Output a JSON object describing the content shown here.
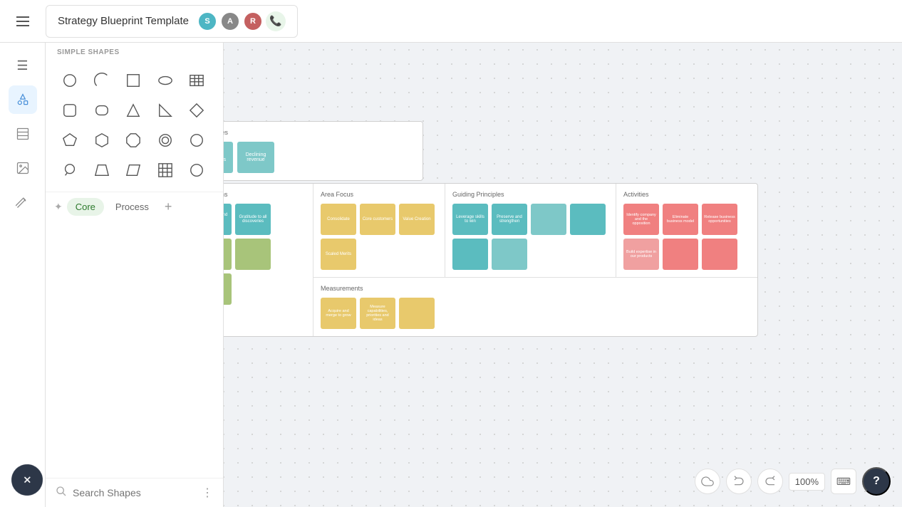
{
  "topbar": {
    "menu_label": "☰",
    "doc_title": "Strategy Blueprint Template"
  },
  "avatars": [
    {
      "initial": "S",
      "color": "#4db6c4"
    },
    {
      "initial": "A",
      "color": "#888"
    },
    {
      "initial": "R",
      "color": "#c46060"
    }
  ],
  "sidebar": {
    "items": [
      {
        "name": "menu-icon",
        "icon": "☰",
        "active": false
      },
      {
        "name": "shapes-icon",
        "icon": "✦",
        "active": true
      },
      {
        "name": "frame-icon",
        "icon": "⊞",
        "active": false
      },
      {
        "name": "image-icon",
        "icon": "🖼",
        "active": false
      },
      {
        "name": "draw-icon",
        "icon": "✏",
        "active": false
      }
    ]
  },
  "shapes_panel": {
    "section_label": "SIMPLE SHAPES",
    "tabs": [
      {
        "label": "Core",
        "active": true
      },
      {
        "label": "Process",
        "active": false
      }
    ],
    "add_tab_label": "+",
    "search_placeholder": "Search Shapes",
    "more_options_label": "⋮",
    "shapes": [
      "circle",
      "arc",
      "square",
      "ellipse",
      "table",
      "rounded-rect",
      "squircle",
      "triangle",
      "right-triangle",
      "diamond",
      "pentagon",
      "hexagon",
      "octagon",
      "circle2",
      "circle3",
      "callout",
      "trapezoid",
      "parallelogram",
      "grid-table",
      "circle4"
    ]
  },
  "diagram": {
    "challenges": {
      "label": "Challenges",
      "stickies": [
        {
          "text": "Losing customers",
          "color": "#7ec8c8"
        },
        {
          "text": "Declining revenue",
          "color": "#7ec8c8"
        }
      ]
    },
    "aspirations": {
      "label": "Aspirations",
      "stickies": [
        {
          "text": "Beloved brand to our customers",
          "color": "#5bbcbf"
        },
        {
          "text": "Gratitude to all our discoveries",
          "color": "#5bbcbf"
        },
        {
          "text": "",
          "color": "#a8c47a"
        },
        {
          "text": "",
          "color": "#a8c47a"
        },
        {
          "text": "",
          "color": "#a8c47a"
        }
      ]
    },
    "area_focus": {
      "label": "Area Focus",
      "stickies": [
        {
          "text": "Consolidate",
          "color": "#e8c96c"
        },
        {
          "text": "Core customers",
          "color": "#e8c96c"
        },
        {
          "text": "Value Creation",
          "color": "#e8c96c"
        },
        {
          "text": "Scaled Merits",
          "color": "#e8c96c"
        }
      ]
    },
    "guiding_principles": {
      "label": "Guiding Principles",
      "stickies": [
        {
          "text": "Leverage skills to win",
          "color": "#5bbcbf"
        },
        {
          "text": "Preserve and strengthen",
          "color": "#5bbcbf"
        },
        {
          "text": "",
          "color": "#7ec8c8"
        },
        {
          "text": "",
          "color": "#5bbcbf"
        },
        {
          "text": "",
          "color": "#5bbcbf"
        },
        {
          "text": "",
          "color": "#7ec8c8"
        }
      ]
    },
    "activities": {
      "label": "Activities",
      "stickies": [
        {
          "text": "Identify company and the opposition",
          "color": "#f08080"
        },
        {
          "text": "Eliminate business model",
          "color": "#f08080"
        },
        {
          "text": "Release business opportunities",
          "color": "#f08080"
        },
        {
          "text": "Build expertise in our products",
          "color": "#f0a0a0"
        },
        {
          "text": "",
          "color": "#f08080"
        },
        {
          "text": "",
          "color": "#f08080"
        }
      ]
    },
    "measurements": {
      "label": "Measurements",
      "stickies": [
        {
          "text": "Acquire and merge to grow",
          "color": "#e8c96c"
        },
        {
          "text": "Measure capabilities, priorities and ideas",
          "color": "#e8c96c"
        },
        {
          "text": "",
          "color": "#e8c96c"
        }
      ]
    }
  },
  "bottom_bar": {
    "zoom_level": "100%",
    "undo_icon": "↩",
    "redo_icon": "↪",
    "cloud_icon": "☁",
    "keyboard_icon": "⌨",
    "help_label": "?"
  },
  "fab": {
    "label": "+"
  }
}
